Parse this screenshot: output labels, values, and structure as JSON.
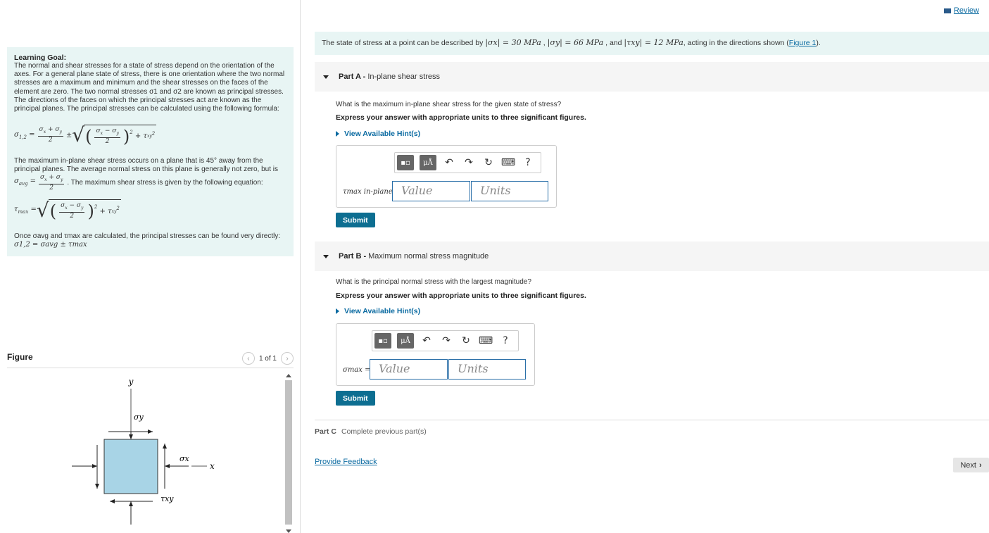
{
  "header": {
    "review_label": "Review"
  },
  "learning_goal": {
    "title": "Learning Goal:",
    "intro": "The normal and shear stresses for a state of stress depend on the orientation of the axes. For a general plane state of stress, there is one orientation where the two normal stresses are a maximum and minimum and the shear stresses on the faces of the element are zero. The two normal stresses σ1 and σ2 are known as principal stresses. The directions of the faces on which the principal stresses act are known as the principal planes. The principal stresses can be calculated using the following formula:",
    "para2_a": "The maximum in-plane shear stress occurs on a plane that is 45° away from the principal planes. The average normal stress on this plane is generally not zero, but is",
    "para2_b": ". The maximum shear stress is given by the following equation:",
    "para3": "Once σavg and τmax are calculated, the principal stresses can be found very directly:",
    "para3_formula": "σ1,2 = σavg ± τmax"
  },
  "figure": {
    "title": "Figure",
    "pager": "1 of 1",
    "labels": {
      "y": "y",
      "x": "x",
      "sigma_y": "σy",
      "sigma_x": "σx",
      "tau_xy": "τxy"
    },
    "colors": {
      "element_fill": "#a8d4e6"
    }
  },
  "statement": {
    "text_a": "The state of stress at a point can be described by",
    "sx": "|σx| = 30 MPa",
    "sy": "|σy| = 66 MPa",
    "txy": "|τxy| = 12 MPa",
    "text_b": ", acting in the directions shown (",
    "figure_link": "Figure 1",
    "text_c": ")."
  },
  "part_a": {
    "label": "Part A -",
    "title": "In-plane shear stress",
    "question": "What is the maximum in-plane shear stress for the given state of stress?",
    "instruction": "Express your answer with appropriate units to three significant figures.",
    "hint": "View Available Hint(s)",
    "answer_label": "τmax in-plane =",
    "value_placeholder": "Value",
    "units_placeholder": "Units",
    "submit": "Submit"
  },
  "part_b": {
    "label": "Part B -",
    "title": "Maximum normal stress magnitude",
    "question": "What is the principal normal stress with the largest magnitude?",
    "instruction": "Express your answer with appropriate units to three significant figures.",
    "hint": "View Available Hint(s)",
    "answer_label": "σmax =",
    "value_placeholder": "Value",
    "units_placeholder": "Units",
    "submit": "Submit"
  },
  "part_c": {
    "label": "Part C",
    "text": "Complete previous part(s)"
  },
  "footer": {
    "feedback": "Provide Feedback",
    "next": "Next"
  },
  "toolbar": {
    "mu_label": "μÅ",
    "help": "?"
  }
}
